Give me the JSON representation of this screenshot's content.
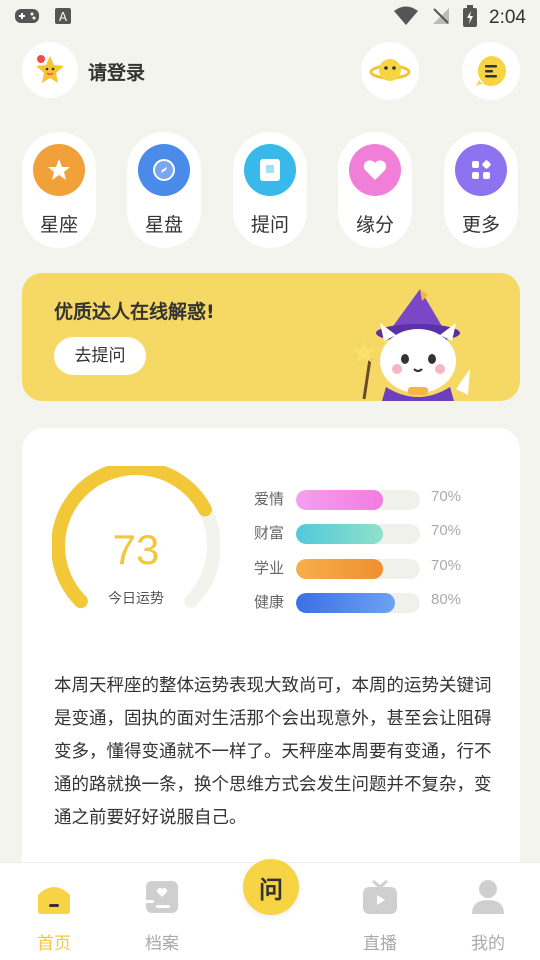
{
  "status_bar": {
    "time": "2:04"
  },
  "header": {
    "login_label": "请登录"
  },
  "quick_items": [
    {
      "label": "星座",
      "icon": "star-icon",
      "color": "#f0a13a"
    },
    {
      "label": "星盘",
      "icon": "compass-icon",
      "color": "#4a8ae9"
    },
    {
      "label": "提问",
      "icon": "note-icon",
      "color": "#38b9ea"
    },
    {
      "label": "缘分",
      "icon": "heart-icon",
      "color": "#f07fd7"
    },
    {
      "label": "更多",
      "icon": "grid-icon",
      "color": "#8d73f0"
    }
  ],
  "banner": {
    "title": "优质达人在线解惑!",
    "button": "去提问"
  },
  "fortune": {
    "score": "73",
    "score_label": "今日运势",
    "score_fraction": 0.73,
    "bars": [
      {
        "label": "爱情",
        "percent": "70%",
        "value": 0.7,
        "from": "#f4a0f0",
        "to": "#f37be0"
      },
      {
        "label": "财富",
        "percent": "70%",
        "value": 0.7,
        "from": "#52c9d9",
        "to": "#8fe1cc"
      },
      {
        "label": "学业",
        "percent": "70%",
        "value": 0.7,
        "from": "#f6b04c",
        "to": "#f08f2f"
      },
      {
        "label": "健康",
        "percent": "80%",
        "value": 0.8,
        "from": "#3c6fe5",
        "to": "#6ea2f2"
      }
    ],
    "text": "本周天秤座的整体运势表现大致尚可，本周的运势关键词是变通，固执的面对生活那个会出现意外，甚至会让阻碍变多，懂得变通就不一样了。天秤座本周要有变通，行不通的路就换一条，换个思维方式会发生问题并不复杂，变通之前要好好说服自己。"
  },
  "nav": {
    "items": [
      {
        "label": "首页",
        "icon": "home-icon"
      },
      {
        "label": "档案",
        "icon": "profile-card-icon"
      },
      {
        "label": "直播",
        "icon": "tv-icon"
      },
      {
        "label": "我的",
        "icon": "user-icon"
      }
    ],
    "center_label": "问"
  }
}
